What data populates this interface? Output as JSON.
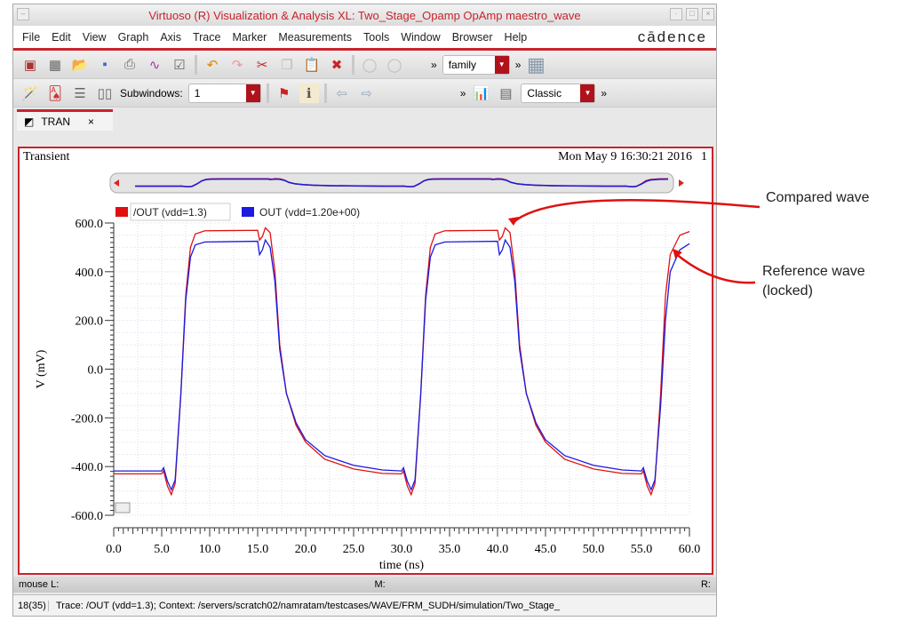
{
  "window": {
    "title": "Virtuoso (R) Visualization & Analysis XL: Two_Stage_Opamp OpAmp maestro_wave"
  },
  "menu": [
    "File",
    "Edit",
    "View",
    "Graph",
    "Axis",
    "Trace",
    "Marker",
    "Measurements",
    "Tools",
    "Window",
    "Browser",
    "Help"
  ],
  "brand": "cādence",
  "toolbar": {
    "family_value": "family",
    "subwindows_label": "Subwindows:",
    "subwindows_value": "1",
    "style_value": "Classic",
    "more": "»"
  },
  "tab": {
    "label": "TRAN",
    "close": "×"
  },
  "panel": {
    "title": "Transient",
    "timestamp": "Mon May 9 16:30:21 2016",
    "index": "1"
  },
  "legend": [
    {
      "label": "/OUT (vdd=1.3)",
      "color": "#e01010"
    },
    {
      "label": "OUT (vdd=1.20e+00)",
      "color": "#1a1ae0"
    }
  ],
  "chart_data": {
    "type": "line",
    "xlabel": "time (ns)",
    "ylabel": "V (mV)",
    "xlim": [
      0,
      60
    ],
    "ylim": [
      -600,
      600
    ],
    "xticks": [
      "0.0",
      "5.0",
      "10.0",
      "15.0",
      "20.0",
      "25.0",
      "30.0",
      "35.0",
      "40.0",
      "45.0",
      "50.0",
      "55.0",
      "60.0"
    ],
    "yticks": [
      "600.0",
      "400.0",
      "200.0",
      "0.0",
      "-200.0",
      "-400.0",
      "-600.0"
    ],
    "series": [
      {
        "name": "/OUT (vdd=1.3)",
        "color": "#e01010",
        "points": [
          [
            0,
            -430
          ],
          [
            5,
            -430
          ],
          [
            5.2,
            -418
          ],
          [
            5.6,
            -480
          ],
          [
            6,
            -515
          ],
          [
            6.4,
            -470
          ],
          [
            7,
            -100
          ],
          [
            7.5,
            300
          ],
          [
            8,
            500
          ],
          [
            8.5,
            555
          ],
          [
            9.5,
            568
          ],
          [
            15,
            570
          ],
          [
            15.2,
            530
          ],
          [
            15.5,
            545
          ],
          [
            15.8,
            580
          ],
          [
            16.3,
            560
          ],
          [
            16.8,
            400
          ],
          [
            17.3,
            100
          ],
          [
            18,
            -100
          ],
          [
            19,
            -230
          ],
          [
            20,
            -300
          ],
          [
            22,
            -370
          ],
          [
            25,
            -410
          ],
          [
            28,
            -428
          ],
          [
            30,
            -430
          ],
          [
            30.2,
            -418
          ],
          [
            30.6,
            -480
          ],
          [
            31,
            -515
          ],
          [
            31.4,
            -470
          ],
          [
            32,
            -100
          ],
          [
            32.5,
            300
          ],
          [
            33,
            500
          ],
          [
            33.5,
            555
          ],
          [
            34.5,
            568
          ],
          [
            40,
            570
          ],
          [
            40.2,
            530
          ],
          [
            40.5,
            545
          ],
          [
            40.8,
            580
          ],
          [
            41.3,
            560
          ],
          [
            41.8,
            400
          ],
          [
            42.3,
            100
          ],
          [
            43,
            -100
          ],
          [
            44,
            -230
          ],
          [
            45,
            -300
          ],
          [
            47,
            -370
          ],
          [
            50,
            -410
          ],
          [
            53,
            -428
          ],
          [
            55,
            -430
          ],
          [
            55.2,
            -418
          ],
          [
            55.6,
            -480
          ],
          [
            56,
            -515
          ],
          [
            56.4,
            -470
          ],
          [
            57,
            -100
          ],
          [
            57.5,
            300
          ],
          [
            58,
            470
          ],
          [
            59,
            550
          ],
          [
            60,
            565
          ]
        ]
      },
      {
        "name": "OUT (vdd=1.20e+00)",
        "color": "#1a1ae0",
        "points": [
          [
            0,
            -418
          ],
          [
            5,
            -418
          ],
          [
            5.2,
            -405
          ],
          [
            5.6,
            -460
          ],
          [
            6,
            -495
          ],
          [
            6.4,
            -455
          ],
          [
            7,
            -100
          ],
          [
            7.5,
            280
          ],
          [
            8,
            460
          ],
          [
            8.5,
            510
          ],
          [
            9.5,
            522
          ],
          [
            15,
            525
          ],
          [
            15.2,
            470
          ],
          [
            15.5,
            490
          ],
          [
            15.8,
            530
          ],
          [
            16.3,
            500
          ],
          [
            16.8,
            360
          ],
          [
            17.3,
            80
          ],
          [
            18,
            -100
          ],
          [
            19,
            -220
          ],
          [
            20,
            -290
          ],
          [
            22,
            -355
          ],
          [
            25,
            -395
          ],
          [
            28,
            -414
          ],
          [
            30,
            -418
          ],
          [
            30.2,
            -405
          ],
          [
            30.6,
            -460
          ],
          [
            31,
            -495
          ],
          [
            31.4,
            -455
          ],
          [
            32,
            -100
          ],
          [
            32.5,
            280
          ],
          [
            33,
            460
          ],
          [
            33.5,
            510
          ],
          [
            34.5,
            522
          ],
          [
            40,
            525
          ],
          [
            40.2,
            470
          ],
          [
            40.5,
            490
          ],
          [
            40.8,
            530
          ],
          [
            41.3,
            500
          ],
          [
            41.8,
            360
          ],
          [
            42.3,
            80
          ],
          [
            43,
            -100
          ],
          [
            44,
            -220
          ],
          [
            45,
            -290
          ],
          [
            47,
            -355
          ],
          [
            50,
            -395
          ],
          [
            53,
            -414
          ],
          [
            55,
            -418
          ],
          [
            55.2,
            -405
          ],
          [
            55.6,
            -460
          ],
          [
            56,
            -495
          ],
          [
            56.4,
            -455
          ],
          [
            57,
            -150
          ],
          [
            57.5,
            200
          ],
          [
            58,
            400
          ],
          [
            59,
            490
          ],
          [
            60,
            515
          ]
        ]
      }
    ]
  },
  "status": {
    "mouse_l": "mouse L:",
    "mouse_m": "M:",
    "mouse_r": "R:",
    "count": "18(35)",
    "message": "Trace: /OUT (vdd=1.3); Context: /servers/scratch02/namratam/testcases/WAVE/FRM_SUDH/simulation/Two_Stage_"
  },
  "annotations": {
    "compared": "Compared wave",
    "reference": "Reference wave (locked)"
  }
}
